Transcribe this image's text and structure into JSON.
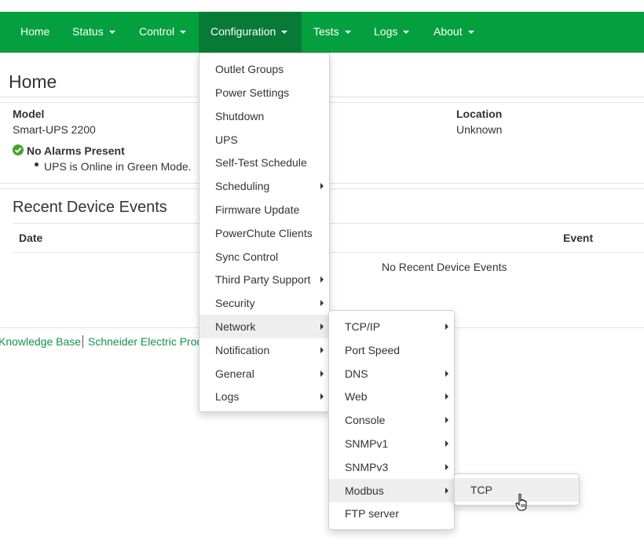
{
  "nav": {
    "items": [
      {
        "label": "Home"
      },
      {
        "label": "Status"
      },
      {
        "label": "Control"
      },
      {
        "label": "Configuration"
      },
      {
        "label": "Tests"
      },
      {
        "label": "Logs"
      },
      {
        "label": "About"
      }
    ]
  },
  "page": {
    "title": "Home",
    "model_label": "Model",
    "model_value": "Smart-UPS 2200",
    "location_label": "Location",
    "location_value": "Unknown",
    "alarm_status": "No Alarms Present",
    "alarm_detail": "UPS is Online in Green Mode.",
    "events_title": "Recent Device Events",
    "events_col_date": "Date",
    "events_col_event": "Event",
    "events_empty": "No Recent Device Events"
  },
  "footer": {
    "link1": "Knowledge Base",
    "link2": "Schneider Electric Prod"
  },
  "config_menu": {
    "items": [
      {
        "label": "Outlet Groups",
        "submenu": false
      },
      {
        "label": "Power Settings",
        "submenu": false
      },
      {
        "label": "Shutdown",
        "submenu": false
      },
      {
        "label": "UPS",
        "submenu": false
      },
      {
        "label": "Self-Test Schedule",
        "submenu": false
      },
      {
        "label": "Scheduling",
        "submenu": true
      },
      {
        "label": "Firmware Update",
        "submenu": false
      },
      {
        "label": "PowerChute Clients",
        "submenu": false
      },
      {
        "label": "Sync Control",
        "submenu": false
      },
      {
        "label": "Third Party Support",
        "submenu": true
      },
      {
        "label": "Security",
        "submenu": true
      },
      {
        "label": "Network",
        "submenu": true,
        "highlighted": true
      },
      {
        "label": "Notification",
        "submenu": true
      },
      {
        "label": "General",
        "submenu": true
      },
      {
        "label": "Logs",
        "submenu": true
      }
    ]
  },
  "network_menu": {
    "items": [
      {
        "label": "TCP/IP",
        "submenu": true
      },
      {
        "label": "Port Speed",
        "submenu": false
      },
      {
        "label": "DNS",
        "submenu": true
      },
      {
        "label": "Web",
        "submenu": true
      },
      {
        "label": "Console",
        "submenu": true
      },
      {
        "label": "SNMPv1",
        "submenu": true
      },
      {
        "label": "SNMPv3",
        "submenu": true
      },
      {
        "label": "Modbus",
        "submenu": true,
        "highlighted": true
      },
      {
        "label": "FTP server",
        "submenu": false
      }
    ]
  },
  "modbus_menu": {
    "items": [
      {
        "label": "TCP"
      }
    ]
  },
  "colors": {
    "navbar": "#04a03f",
    "navbar_active": "#077a35",
    "link": "#14924a",
    "status_ok": "#4aa02c"
  }
}
